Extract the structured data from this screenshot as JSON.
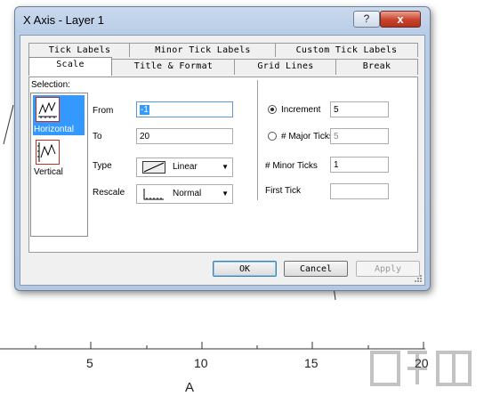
{
  "window": {
    "title": "X Axis - Layer 1",
    "help_label": "?",
    "close_label": "x"
  },
  "tabs": {
    "row_back": [
      "Tick Labels",
      "Minor Tick Labels",
      "Custom Tick Labels"
    ],
    "row_front": [
      "Scale",
      "Title & Format",
      "Grid Lines",
      "Break"
    ],
    "active": "Scale"
  },
  "selection": {
    "label": "Selection:",
    "items": [
      {
        "label": "Horizontal",
        "icon": "horizontal-axis-icon",
        "selected": true
      },
      {
        "label": "Vertical",
        "icon": "vertical-axis-icon",
        "selected": false
      }
    ]
  },
  "scale": {
    "from_label": "From",
    "from_value": "-1",
    "to_label": "To",
    "to_value": "20",
    "type_label": "Type",
    "type_value": "Linear",
    "rescale_label": "Rescale",
    "rescale_value": "Normal"
  },
  "ticks": {
    "increment_label": "Increment",
    "increment_value": "5",
    "major_label": "# Major Ticks",
    "major_value": "5",
    "minor_label": "# Minor Ticks",
    "minor_value": "1",
    "first_label": "First Tick",
    "first_value": "",
    "selected_option": "Increment"
  },
  "buttons": {
    "ok": "OK",
    "cancel": "Cancel",
    "apply": "Apply"
  },
  "background_plot": {
    "tick_labels": [
      "5",
      "10",
      "15",
      "20"
    ],
    "axis_title": "A"
  },
  "colors": {
    "selection": "#3399ff",
    "close": "#c8412c",
    "frame": "#b8cde6"
  }
}
